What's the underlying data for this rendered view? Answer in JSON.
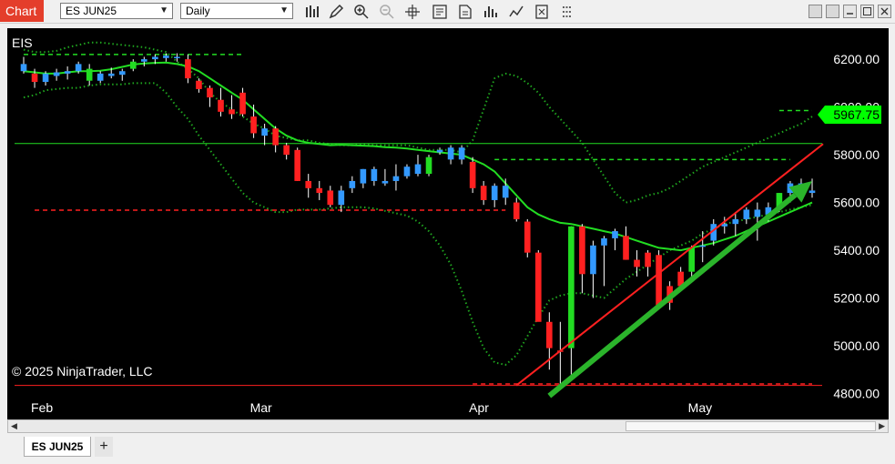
{
  "toolbar": {
    "app_label": "Chart",
    "instrument": "ES JUN25",
    "period": "Daily",
    "tools": [
      "bar-style-icon",
      "draw-icon",
      "zoom-in-icon",
      "zoom-out-icon",
      "crosshair-icon",
      "data-box-icon",
      "properties-icon",
      "indicators-icon",
      "strategies-icon",
      "templates-icon",
      "more-icon"
    ]
  },
  "window": {
    "buttons": [
      "tile-icon",
      "minimize-icon",
      "maximize-icon",
      "close-icon"
    ]
  },
  "chart": {
    "instrument_label": "EIS",
    "copyright": "© 2025 NinjaTrader, LLC",
    "price_label": "5967.75",
    "colors": {
      "up": "#3399ff",
      "down": "#ff2020",
      "indicator": "#22dd22",
      "price_tag": "#00ff00",
      "support": "#ff2020"
    }
  },
  "chart_data": {
    "type": "line",
    "ylim": [
      4760,
      6330
    ],
    "yticks": [
      "6200.00",
      "6000.00",
      "5800.00",
      "5600.00",
      "5400.00",
      "5200.00",
      "5000.00",
      "4800.00"
    ],
    "ytick_values": [
      6200,
      6000,
      5800,
      5600,
      5400,
      5200,
      5000,
      4800
    ],
    "xticks": [
      "Feb",
      "Mar",
      "Apr",
      "May"
    ],
    "xtick_index": [
      1,
      21,
      41,
      61
    ],
    "bar_count": 73,
    "candles": [
      [
        6180,
        6210,
        6140,
        6150,
        "up"
      ],
      [
        6140,
        6160,
        6080,
        6105,
        "down"
      ],
      [
        6105,
        6150,
        6090,
        6140,
        "up"
      ],
      [
        6130,
        6160,
        6110,
        6145,
        "up"
      ],
      [
        6140,
        6170,
        6115,
        6150,
        "up"
      ],
      [
        6150,
        6190,
        6140,
        6180,
        "up"
      ],
      [
        6160,
        6180,
        6090,
        6110,
        "green"
      ],
      [
        6110,
        6150,
        6100,
        6140,
        "up"
      ],
      [
        6140,
        6165,
        6120,
        6130,
        "up"
      ],
      [
        6135,
        6160,
        6110,
        6150,
        "up"
      ],
      [
        6160,
        6200,
        6150,
        6190,
        "green"
      ],
      [
        6190,
        6210,
        6170,
        6200,
        "up"
      ],
      [
        6200,
        6220,
        6180,
        6210,
        "up"
      ],
      [
        6205,
        6225,
        6190,
        6215,
        "up"
      ],
      [
        6210,
        6225,
        6190,
        6210,
        "up"
      ],
      [
        6200,
        6220,
        6100,
        6120,
        "down"
      ],
      [
        6110,
        6120,
        6060,
        6075,
        "down"
      ],
      [
        6080,
        6090,
        6000,
        6040,
        "down"
      ],
      [
        6030,
        6080,
        5960,
        5980,
        "down"
      ],
      [
        5990,
        6050,
        5950,
        5970,
        "down"
      ],
      [
        6060,
        6080,
        5960,
        5970,
        "down"
      ],
      [
        5960,
        6010,
        5870,
        5890,
        "down"
      ],
      [
        5880,
        5930,
        5840,
        5910,
        "up"
      ],
      [
        5910,
        5920,
        5810,
        5840,
        "down"
      ],
      [
        5840,
        5850,
        5780,
        5800,
        "down"
      ],
      [
        5820,
        5830,
        5690,
        5690,
        "down"
      ],
      [
        5690,
        5720,
        5620,
        5660,
        "down"
      ],
      [
        5660,
        5690,
        5610,
        5640,
        "down"
      ],
      [
        5650,
        5670,
        5580,
        5590,
        "down"
      ],
      [
        5590,
        5670,
        5560,
        5650,
        "up"
      ],
      [
        5660,
        5710,
        5640,
        5690,
        "up"
      ],
      [
        5680,
        5740,
        5660,
        5740,
        "up"
      ],
      [
        5690,
        5750,
        5670,
        5740,
        "up"
      ],
      [
        5690,
        5740,
        5670,
        5680,
        "up"
      ],
      [
        5690,
        5760,
        5650,
        5710,
        "up"
      ],
      [
        5710,
        5760,
        5700,
        5750,
        "up"
      ],
      [
        5760,
        5800,
        5710,
        5720,
        "up"
      ],
      [
        5720,
        5800,
        5710,
        5790,
        "green"
      ],
      [
        5820,
        5830,
        5800,
        5810,
        "up"
      ],
      [
        5780,
        5840,
        5760,
        5830,
        "up"
      ],
      [
        5830,
        5840,
        5760,
        5780,
        "up"
      ],
      [
        5770,
        5790,
        5640,
        5660,
        "down"
      ],
      [
        5670,
        5690,
        5590,
        5610,
        "down"
      ],
      [
        5610,
        5680,
        5580,
        5670,
        "up"
      ],
      [
        5670,
        5700,
        5590,
        5620,
        "up"
      ],
      [
        5600,
        5620,
        5520,
        5530,
        "down"
      ],
      [
        5520,
        5530,
        5370,
        5390,
        "down"
      ],
      [
        5390,
        5400,
        5110,
        5100,
        "down"
      ],
      [
        5100,
        5140,
        4900,
        4990,
        "down"
      ],
      [
        4980,
        5100,
        4820,
        4980,
        "down"
      ],
      [
        4990,
        5500,
        4880,
        5500,
        "green"
      ],
      [
        5500,
        5510,
        5220,
        5300,
        "down"
      ],
      [
        5300,
        5440,
        5200,
        5420,
        "up"
      ],
      [
        5420,
        5460,
        5250,
        5450,
        "up"
      ],
      [
        5450,
        5490,
        5400,
        5480,
        "up"
      ],
      [
        5460,
        5500,
        5360,
        5360,
        "down"
      ],
      [
        5360,
        5400,
        5290,
        5330,
        "down"
      ],
      [
        5330,
        5400,
        5290,
        5390,
        "down"
      ],
      [
        5380,
        5400,
        5170,
        5170,
        "down"
      ],
      [
        5180,
        5270,
        5150,
        5250,
        "down"
      ],
      [
        5250,
        5330,
        5240,
        5310,
        "down"
      ],
      [
        5310,
        5420,
        5290,
        5410,
        "green"
      ],
      [
        5420,
        5480,
        5350,
        5420,
        "up"
      ],
      [
        5440,
        5530,
        5420,
        5510,
        "up"
      ],
      [
        5510,
        5540,
        5470,
        5500,
        "up"
      ],
      [
        5510,
        5560,
        5460,
        5530,
        "up"
      ],
      [
        5530,
        5580,
        5510,
        5570,
        "up"
      ],
      [
        5570,
        5600,
        5440,
        5540,
        "up"
      ],
      [
        5550,
        5600,
        5520,
        5580,
        "up"
      ],
      [
        5580,
        5640,
        5560,
        5640,
        "green"
      ],
      [
        5640,
        5690,
        5600,
        5680,
        "up"
      ],
      [
        5680,
        5700,
        5620,
        5640,
        "up"
      ],
      [
        5640,
        5700,
        5620,
        5650,
        "up"
      ]
    ],
    "indicator": [
      6150,
      6145,
      6140,
      6140,
      6145,
      6150,
      6150,
      6152,
      6158,
      6168,
      6178,
      6182,
      6185,
      6186,
      6180,
      6170,
      6150,
      6120,
      6090,
      6060,
      6030,
      5990,
      5950,
      5910,
      5880,
      5860,
      5850,
      5845,
      5840,
      5842,
      5840,
      5838,
      5836,
      5832,
      5830,
      5826,
      5820,
      5815,
      5810,
      5805,
      5800,
      5780,
      5760,
      5730,
      5680,
      5630,
      5580,
      5550,
      5530,
      5515,
      5510,
      5500,
      5490,
      5480,
      5470,
      5455,
      5440,
      5425,
      5410,
      5405,
      5400,
      5410,
      5420,
      5430,
      5445,
      5460,
      5480,
      5500,
      5520,
      5540,
      5560,
      5580,
      5600
    ],
    "upper_band": [
      6240,
      6230,
      6230,
      6235,
      6250,
      6260,
      6270,
      6270,
      6265,
      6260,
      6255,
      6250,
      6240,
      6230,
      6190,
      6160,
      6120,
      6060,
      6020,
      5990,
      5960,
      5930,
      5910,
      5880,
      5870,
      5860,
      5860,
      5850,
      5845,
      5840,
      5840,
      5845,
      5840,
      5840,
      5840,
      5840,
      5830,
      5820,
      5820,
      5820,
      5810,
      5860,
      5990,
      6120,
      6140,
      6130,
      6100,
      6060,
      6000,
      5950,
      5900,
      5850,
      5780,
      5710,
      5640,
      5600,
      5610,
      5630,
      5640,
      5660,
      5690,
      5720,
      5750,
      5770,
      5790,
      5810,
      5830,
      5850,
      5870,
      5890,
      5910,
      5930,
      5960
    ],
    "lower_band": [
      6040,
      6050,
      6070,
      6075,
      6080,
      6080,
      6090,
      6095,
      6095,
      6095,
      6100,
      6100,
      6100,
      6060,
      6000,
      5950,
      5880,
      5820,
      5760,
      5700,
      5640,
      5600,
      5580,
      5560,
      5560,
      5570,
      5570,
      5570,
      5575,
      5580,
      5580,
      5580,
      5575,
      5565,
      5555,
      5545,
      5520,
      5480,
      5420,
      5340,
      5230,
      5100,
      4990,
      4930,
      4920,
      4960,
      5040,
      5120,
      5190,
      5210,
      5220,
      5220,
      5210,
      5200,
      5240,
      5280,
      5310,
      5340,
      5370,
      5400,
      5420,
      5440,
      5470,
      5490,
      5510,
      5520,
      5530,
      5540,
      5550,
      5560,
      5570,
      5580,
      5590
    ],
    "levels": [
      {
        "price": 5847,
        "style": "solid",
        "color": "#22dd22"
      },
      {
        "price": 4834,
        "style": "solid",
        "color": "#ff2020"
      }
    ],
    "dashed_levels": [
      {
        "price": 6220,
        "from": 0,
        "to": 20,
        "color": "#22dd22"
      },
      {
        "price": 5568,
        "from": 1,
        "to": 44,
        "color": "#ff2020"
      },
      {
        "price": 5780,
        "from": 43,
        "to": 70,
        "color": "#22dd22"
      },
      {
        "price": 5985,
        "from": 69,
        "to": 73,
        "color": "#22dd22"
      },
      {
        "price": 4840,
        "from": 41,
        "to": 73,
        "color": "#ff2020"
      }
    ],
    "trendline": {
      "from_index": 45,
      "from_price": 4834,
      "to_index": 73,
      "to_price": 5845,
      "color": "#ff2020"
    },
    "arrow": {
      "from_index": 48,
      "from_price": 4790,
      "to_index": 72,
      "to_price": 5690,
      "color": "#2bb42b"
    },
    "last_price": 5967.75
  }
}
